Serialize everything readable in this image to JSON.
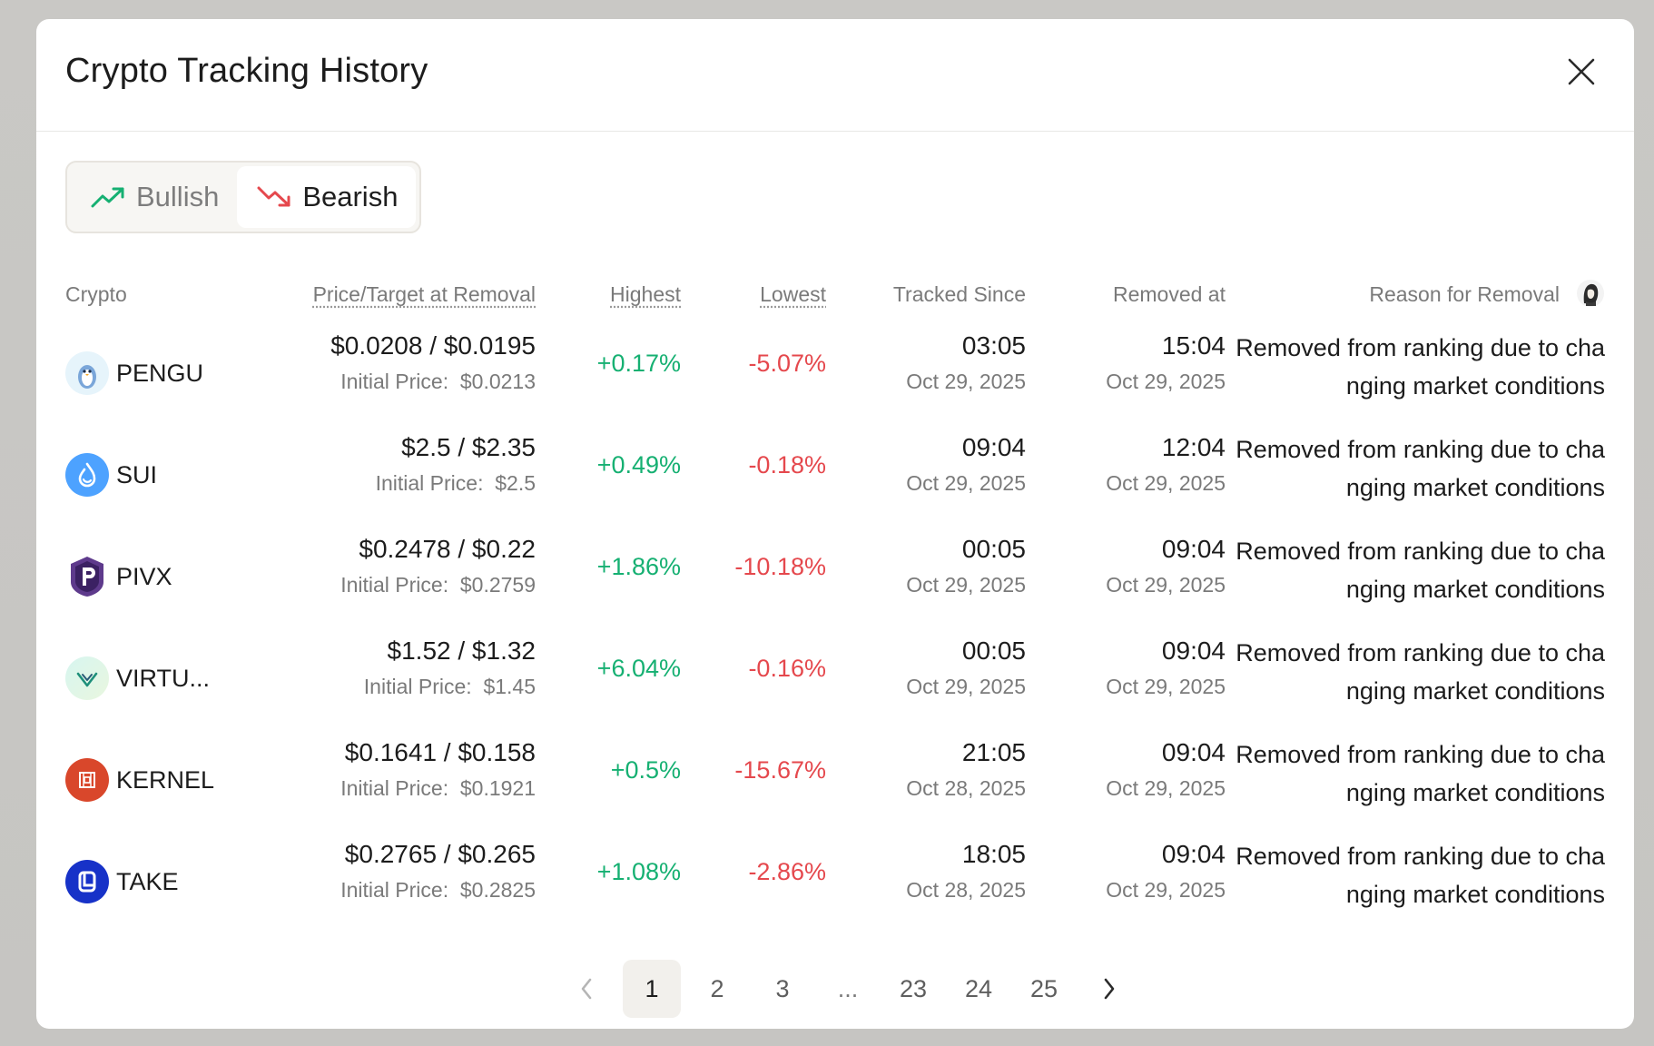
{
  "modal": {
    "title": "Crypto Tracking History"
  },
  "toggle": {
    "bullish_label": "Bullish",
    "bearish_label": "Bearish",
    "active": "Bearish"
  },
  "colors": {
    "positive": "#16b072",
    "negative": "#e5484d",
    "bearish_icon": "#e5484d",
    "bullish_icon": "#16b072"
  },
  "table": {
    "headers": {
      "crypto": "Crypto",
      "price": "Price/Target at Removal",
      "highest": "Highest",
      "lowest": "Lowest",
      "tracked_since": "Tracked Since",
      "removed_at": "Removed at",
      "reason": "Reason for Removal"
    },
    "initial_label": "Initial Price:",
    "rows": [
      {
        "symbol": "PENGU",
        "icon": "pengu-logo-icon",
        "price_target": "$0.0208 / $0.0195",
        "initial": "$0.0213",
        "highest": "+0.17%",
        "lowest": "-5.07%",
        "tracked_time": "03:05",
        "tracked_date": "Oct 29, 2025",
        "removed_time": "15:04",
        "removed_date": "Oct 29, 2025",
        "reason": "Removed from ranking due to changing market conditions"
      },
      {
        "symbol": "SUI",
        "icon": "sui-logo-icon",
        "price_target": "$2.5 / $2.35",
        "initial": "$2.5",
        "highest": "+0.49%",
        "lowest": "-0.18%",
        "tracked_time": "09:04",
        "tracked_date": "Oct 29, 2025",
        "removed_time": "12:04",
        "removed_date": "Oct 29, 2025",
        "reason": "Removed from ranking due to changing market conditions"
      },
      {
        "symbol": "PIVX",
        "icon": "pivx-logo-icon",
        "price_target": "$0.2478 / $0.22",
        "initial": "$0.2759",
        "highest": "+1.86%",
        "lowest": "-10.18%",
        "tracked_time": "00:05",
        "tracked_date": "Oct 29, 2025",
        "removed_time": "09:04",
        "removed_date": "Oct 29, 2025",
        "reason": "Removed from ranking due to changing market conditions"
      },
      {
        "symbol": "VIRTU...",
        "icon": "virtual-logo-icon",
        "price_target": "$1.52 / $1.32",
        "initial": "$1.45",
        "highest": "+6.04%",
        "lowest": "-0.16%",
        "tracked_time": "00:05",
        "tracked_date": "Oct 29, 2025",
        "removed_time": "09:04",
        "removed_date": "Oct 29, 2025",
        "reason": "Removed from ranking due to changing market conditions"
      },
      {
        "symbol": "KERNEL",
        "icon": "kernel-logo-icon",
        "price_target": "$0.1641 / $0.158",
        "initial": "$0.1921",
        "highest": "+0.5%",
        "lowest": "-15.67%",
        "tracked_time": "21:05",
        "tracked_date": "Oct 28, 2025",
        "removed_time": "09:04",
        "removed_date": "Oct 29, 2025",
        "reason": "Removed from ranking due to changing market conditions"
      },
      {
        "symbol": "TAKE",
        "icon": "take-logo-icon",
        "price_target": "$0.2765 / $0.265",
        "initial": "$0.2825",
        "highest": "+1.08%",
        "lowest": "-2.86%",
        "tracked_time": "18:05",
        "tracked_date": "Oct 28, 2025",
        "removed_time": "09:04",
        "removed_date": "Oct 29, 2025",
        "reason": "Removed from ranking due to changing market conditions"
      }
    ]
  },
  "pagination": {
    "current": "1",
    "pages": [
      "1",
      "2",
      "3",
      "...",
      "23",
      "24",
      "25"
    ]
  }
}
